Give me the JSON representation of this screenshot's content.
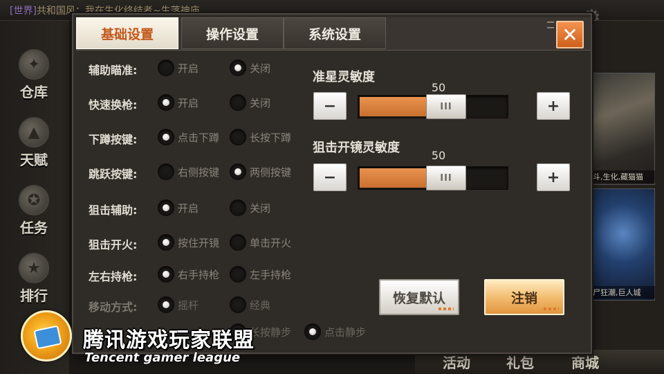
{
  "background": {
    "chat_tag": "[世界]",
    "chat_text": "共和国风：我在生化终结者~生落神庙",
    "nav": [
      {
        "label": "仓库"
      },
      {
        "label": "天赋"
      },
      {
        "label": "任务"
      },
      {
        "label": "排行"
      }
    ],
    "art_caption_1": "斗,生化,藏猫猫",
    "art_caption_2": "尸狂潮,巨人城",
    "bottom_labels": [
      "活动",
      "礼包",
      "商城"
    ]
  },
  "watermark": {
    "cn": "腾讯游戏玩家联盟",
    "en": "Tencent gamer league"
  },
  "dialog": {
    "tabs": [
      {
        "label": "基础设置",
        "active": true
      },
      {
        "label": "操作设置",
        "active": false
      },
      {
        "label": "系统设置",
        "active": false
      }
    ],
    "close_label": "✕",
    "settings": [
      {
        "label": "辅助瞄准:",
        "options": [
          "开启",
          "关闭"
        ],
        "selected": 1
      },
      {
        "label": "快速换枪:",
        "options": [
          "开启",
          "关闭"
        ],
        "selected": 0
      },
      {
        "label": "下蹲按键:",
        "options": [
          "点击下蹲",
          "长按下蹲"
        ],
        "selected": 0
      },
      {
        "label": "跳跃按键:",
        "options": [
          "右侧按键",
          "两侧按键"
        ],
        "selected": 1
      },
      {
        "label": "狙击辅助:",
        "options": [
          "开启",
          "关闭"
        ],
        "selected": 0
      },
      {
        "label": "狙击开火:",
        "options": [
          "按住开镜",
          "单击开火"
        ],
        "selected": 0
      },
      {
        "label": "左右持枪:",
        "options": [
          "右手持枪",
          "左手持枪"
        ],
        "selected": 0
      },
      {
        "label": "移动方式:",
        "options": [
          "摇杆",
          "经典"
        ],
        "selected": 0
      },
      {
        "label": "",
        "options": [
          "点击静步",
          "长按静步"
        ],
        "selected": 0
      }
    ],
    "sliders": [
      {
        "title": "准星灵敏度",
        "value": "50",
        "fill": 0.5,
        "minus": "−",
        "plus": "+",
        "grip": "III"
      },
      {
        "title": "狙击开镜灵敏度",
        "value": "50",
        "fill": 0.5,
        "minus": "−",
        "plus": "+",
        "grip": "III"
      }
    ],
    "buttons": {
      "reset": "恢复默认",
      "logout": "注销"
    }
  }
}
